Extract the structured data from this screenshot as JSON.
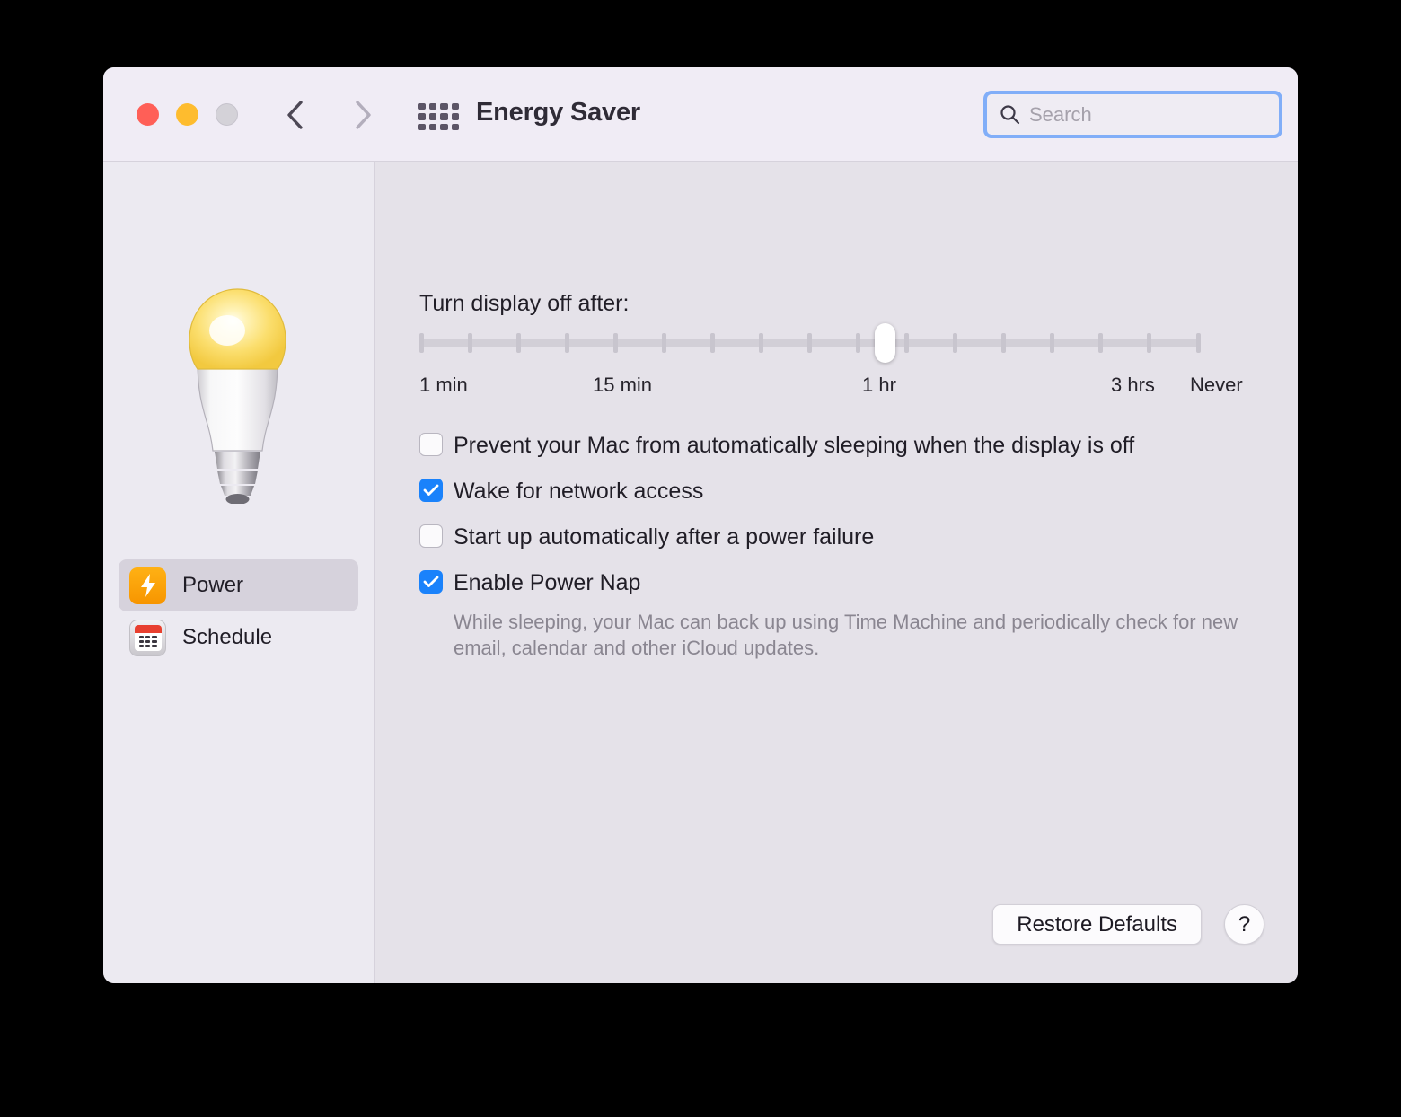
{
  "window": {
    "title": "Energy Saver",
    "traffic_lights": [
      {
        "name": "close",
        "color": "#ff5f57"
      },
      {
        "name": "minimize",
        "color": "#febc2e"
      },
      {
        "name": "zoom",
        "color": "#d4d2d8"
      }
    ],
    "nav": {
      "back_icon": "chevron-left-icon",
      "forward_icon": "chevron-right-icon"
    },
    "grid_icon": "all-preferences-grid-icon"
  },
  "search": {
    "placeholder": "Search",
    "value": "",
    "icon": "search-icon",
    "focused": true,
    "focus_ring_color": "#81aef8"
  },
  "sidebar": {
    "hero_icon": "lightbulb-icon",
    "items": [
      {
        "label": "Power",
        "icon": "power-bolt-icon",
        "selected": true
      },
      {
        "label": "Schedule",
        "icon": "calendar-icon",
        "selected": false
      }
    ]
  },
  "main": {
    "slider": {
      "label": "Turn display off after:",
      "value_label": "1 hr",
      "thumb_position_percent": 59.5,
      "tick_count": 17,
      "captions": [
        {
          "text": "1 min",
          "percent": 0.8,
          "align": "left"
        },
        {
          "text": "15 min",
          "percent": 23,
          "align": "left"
        },
        {
          "text": "1 hr",
          "percent": 58,
          "align": "left"
        },
        {
          "text": "3 hrs",
          "percent": 92,
          "align": "right"
        },
        {
          "text": "Never",
          "percent": 100,
          "align": "right"
        }
      ]
    },
    "checkboxes": [
      {
        "label": "Prevent your Mac from automatically sleeping when the display is off",
        "checked": false
      },
      {
        "label": "Wake for network access",
        "checked": true
      },
      {
        "label": "Start up automatically after a power failure",
        "checked": false
      },
      {
        "label": "Enable Power Nap",
        "checked": true
      }
    ],
    "power_nap_description": "While sleeping, your Mac can back up using Time Machine and periodically check for new email, calendar and other iCloud updates.",
    "restore_defaults_label": "Restore Defaults",
    "help_label": "?"
  },
  "colors": {
    "accent_blue": "#1a82fb",
    "titlebar_bg": "#f0ecf5",
    "sidebar_bg": "#eceaf1",
    "content_bg": "#e5e2e9",
    "power_icon_orange": "#f79500",
    "calendar_red": "#e8402f"
  }
}
